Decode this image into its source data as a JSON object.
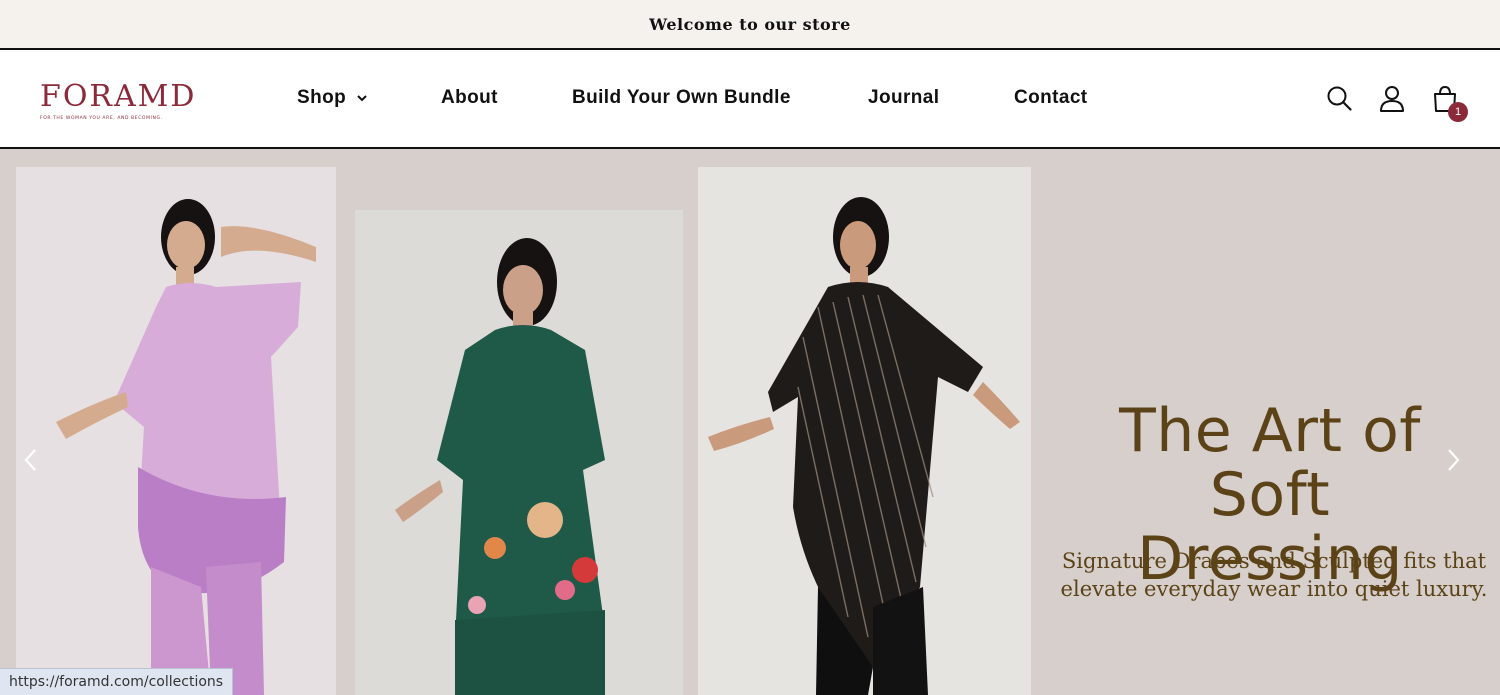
{
  "announcement": {
    "text": "Welcome to our store"
  },
  "logo": {
    "wordmark": "FORAMD",
    "tagline": "FOR THE WOMAN YOU ARE, AND BECOMING."
  },
  "nav": {
    "items": [
      {
        "label": "Shop",
        "has_dropdown": true
      },
      {
        "label": "About"
      },
      {
        "label": "Build Your Own Bundle"
      },
      {
        "label": "Journal"
      },
      {
        "label": "Contact"
      }
    ]
  },
  "header_icons": {
    "search": "search-icon",
    "account": "user-icon",
    "cart": "cart-icon",
    "cart_count": "1"
  },
  "hero": {
    "title_line1": "The Art of Soft",
    "title_line2": "Dressing",
    "subtitle_line1": "Signature Drapes and Sculpted fits that",
    "subtitle_line2": "elevate everyday wear into quiet luxury.",
    "colors": {
      "title": "#5c4317",
      "background": "#d7cfcc"
    },
    "slides": [
      {
        "garment": "lilac ombre kaftan co-ord"
      },
      {
        "garment": "green floral print kurta set"
      },
      {
        "garment": "black striped drape with pants"
      }
    ]
  },
  "brand_color": "#8a2a3a",
  "status_bar": {
    "url": "https://foramd.com/collections"
  }
}
